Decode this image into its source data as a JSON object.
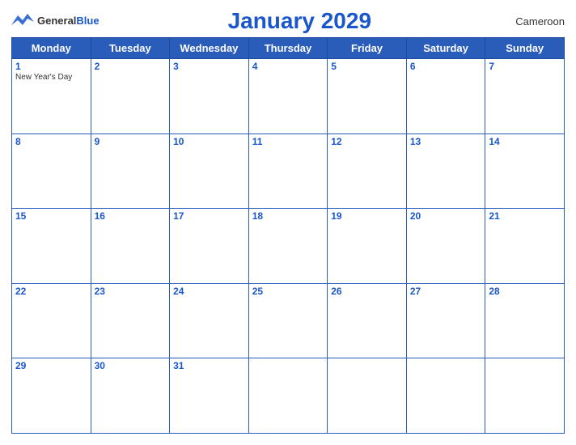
{
  "logo": {
    "general": "General",
    "blue": "Blue"
  },
  "title": "January 2029",
  "country": "Cameroon",
  "headers": [
    "Monday",
    "Tuesday",
    "Wednesday",
    "Thursday",
    "Friday",
    "Saturday",
    "Sunday"
  ],
  "weeks": [
    [
      {
        "day": "1",
        "holiday": "New Year's Day"
      },
      {
        "day": "2",
        "holiday": ""
      },
      {
        "day": "3",
        "holiday": ""
      },
      {
        "day": "4",
        "holiday": ""
      },
      {
        "day": "5",
        "holiday": ""
      },
      {
        "day": "6",
        "holiday": ""
      },
      {
        "day": "7",
        "holiday": ""
      }
    ],
    [
      {
        "day": "8",
        "holiday": ""
      },
      {
        "day": "9",
        "holiday": ""
      },
      {
        "day": "10",
        "holiday": ""
      },
      {
        "day": "11",
        "holiday": ""
      },
      {
        "day": "12",
        "holiday": ""
      },
      {
        "day": "13",
        "holiday": ""
      },
      {
        "day": "14",
        "holiday": ""
      }
    ],
    [
      {
        "day": "15",
        "holiday": ""
      },
      {
        "day": "16",
        "holiday": ""
      },
      {
        "day": "17",
        "holiday": ""
      },
      {
        "day": "18",
        "holiday": ""
      },
      {
        "day": "19",
        "holiday": ""
      },
      {
        "day": "20",
        "holiday": ""
      },
      {
        "day": "21",
        "holiday": ""
      }
    ],
    [
      {
        "day": "22",
        "holiday": ""
      },
      {
        "day": "23",
        "holiday": ""
      },
      {
        "day": "24",
        "holiday": ""
      },
      {
        "day": "25",
        "holiday": ""
      },
      {
        "day": "26",
        "holiday": ""
      },
      {
        "day": "27",
        "holiday": ""
      },
      {
        "day": "28",
        "holiday": ""
      }
    ],
    [
      {
        "day": "29",
        "holiday": ""
      },
      {
        "day": "30",
        "holiday": ""
      },
      {
        "day": "31",
        "holiday": ""
      },
      {
        "day": "",
        "holiday": ""
      },
      {
        "day": "",
        "holiday": ""
      },
      {
        "day": "",
        "holiday": ""
      },
      {
        "day": "",
        "holiday": ""
      }
    ]
  ]
}
